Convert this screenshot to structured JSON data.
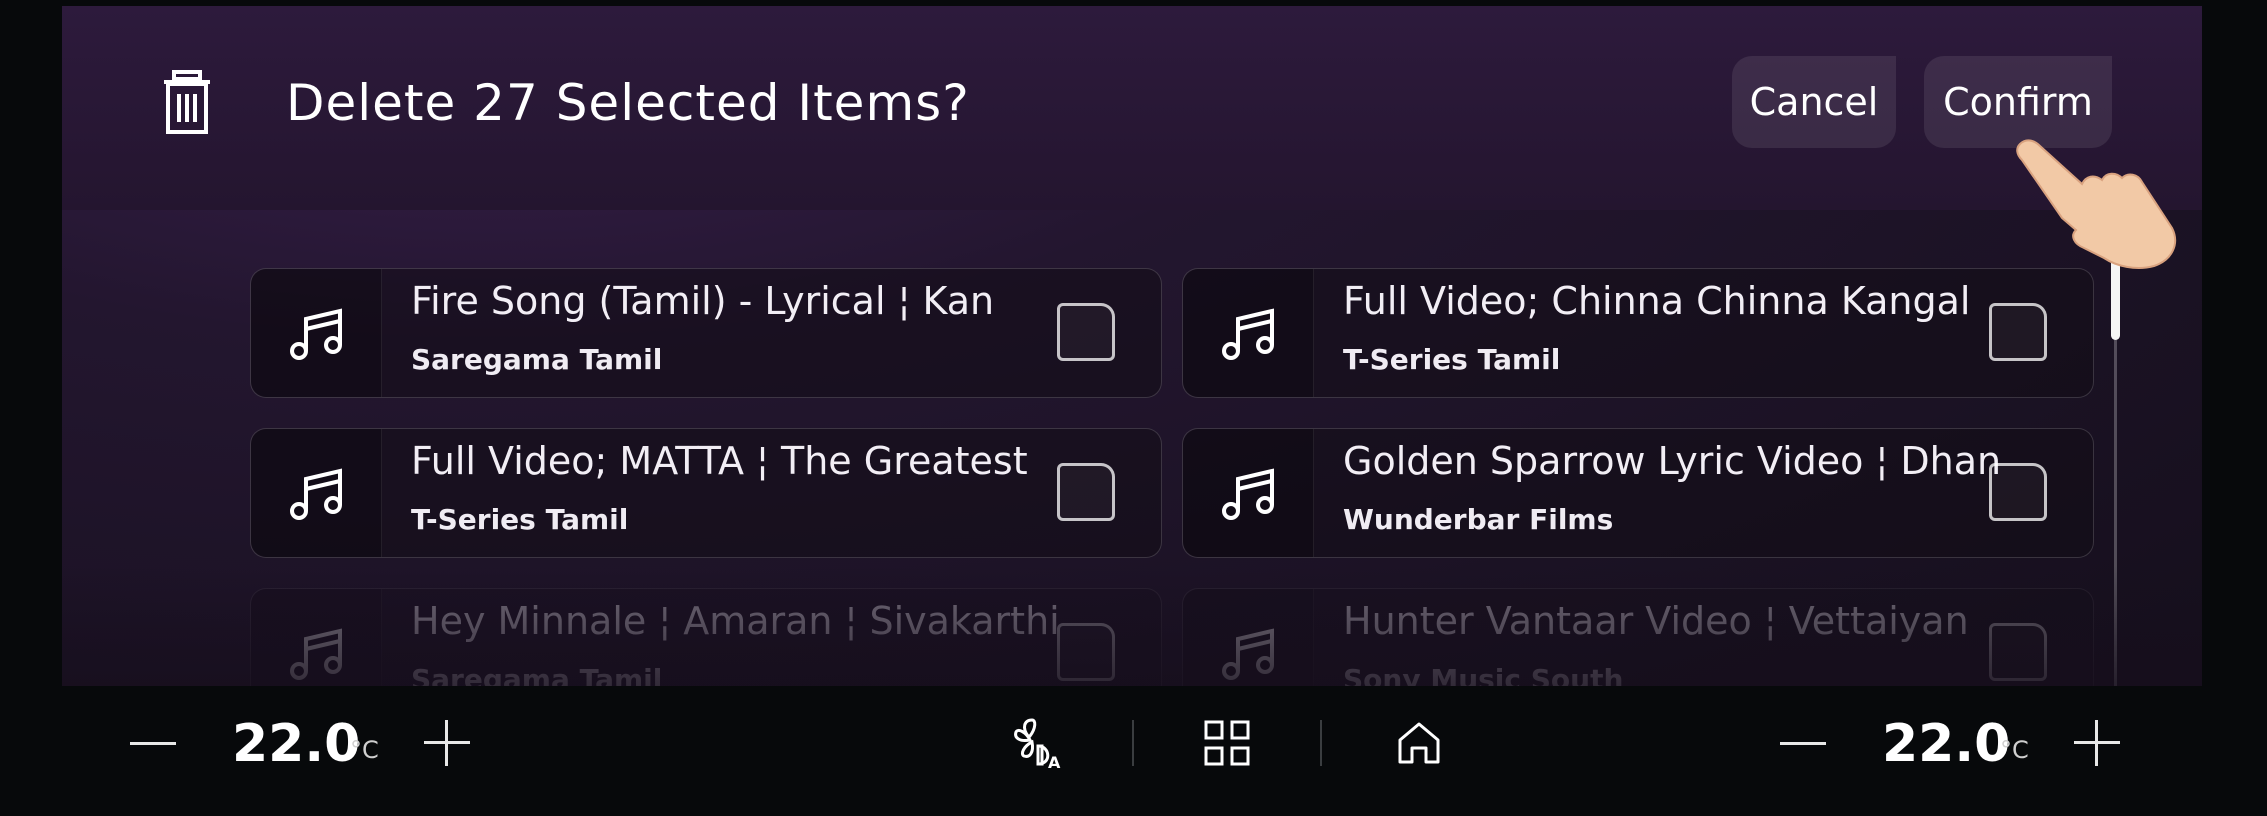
{
  "dialog": {
    "title": "Delete 27 Selected Items?",
    "cancel_label": "Cancel",
    "confirm_label": "Confirm",
    "icon": "trash-icon"
  },
  "items": [
    {
      "title": "Fire Song (Tamil) - Lyrical ¦ Kan",
      "channel": "Saregama Tamil",
      "icon": "music-note-icon",
      "checked": false
    },
    {
      "title": "Full Video; Chinna Chinna Kangal",
      "channel": "T-Series Tamil",
      "icon": "music-note-icon",
      "checked": false
    },
    {
      "title": "Full Video; MATTA ¦ The Greatest",
      "channel": "T-Series Tamil",
      "icon": "music-note-icon",
      "checked": false
    },
    {
      "title": "Golden Sparrow Lyric Video ¦ Dhan",
      "channel": "Wunderbar Films",
      "icon": "music-note-icon",
      "checked": false
    },
    {
      "title": "Hey Minnale ¦ Amaran ¦ Sivakarthi",
      "channel": "Saregama Tamil",
      "icon": "music-note-icon",
      "checked": false
    },
    {
      "title": "Hunter Vantaar Video ¦ Vettaiyan",
      "channel": "Sony Music South",
      "icon": "music-note-icon",
      "checked": false
    }
  ],
  "climate": {
    "left_temp": "22.0",
    "right_temp": "22.0",
    "unit": "°C"
  },
  "dock": {
    "fan_icon": "fan-auto-icon",
    "apps_icon": "apps-grid-icon",
    "home_icon": "home-icon"
  }
}
